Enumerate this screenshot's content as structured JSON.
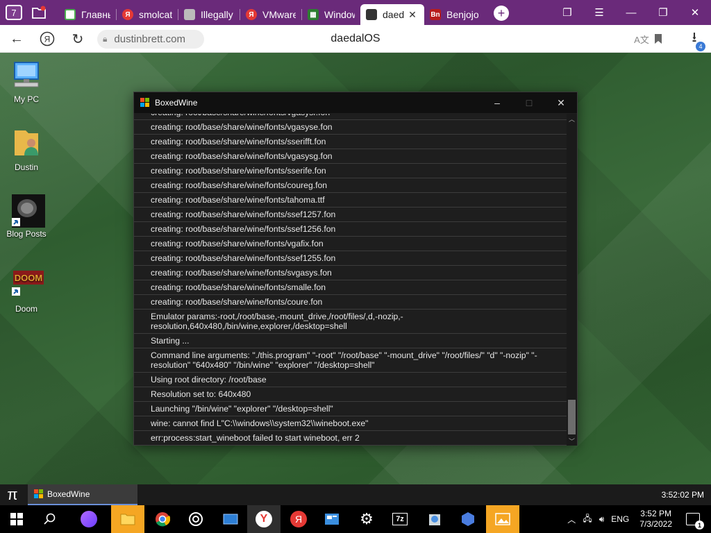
{
  "browser": {
    "tab_counter": "7",
    "tabs": [
      {
        "label": "Главны",
        "fav_color": "#4caf50",
        "icon": "page-icon"
      },
      {
        "label": "smolcat",
        "fav_color": "#e53935",
        "icon": "yandex-icon"
      },
      {
        "label": "Illegally",
        "fav_color": "#9e9e9e",
        "icon": "page-icon"
      },
      {
        "label": "VMware",
        "fav_color": "#e53935",
        "icon": "yandex-icon"
      },
      {
        "label": "Window",
        "fav_color": "#2e7d32",
        "icon": "grid-icon"
      },
      {
        "label": "daed",
        "fav_color": "#333333",
        "icon": "daedalos-icon"
      },
      {
        "label": "Benjojo",
        "fav_color": "#b71c1c",
        "icon": "bn-icon"
      }
    ],
    "url": "dustinbrett.com",
    "page_title": "daedalOS",
    "downloads_count": "4"
  },
  "desktop": {
    "icons": [
      {
        "label": "My PC",
        "icon": "computer-icon"
      },
      {
        "label": "Dustin",
        "icon": "user-folder-icon"
      },
      {
        "label": "Blog Posts",
        "icon": "blog-posts-shortcut-icon"
      },
      {
        "label": "Doom",
        "icon": "doom-shortcut-icon"
      }
    ]
  },
  "window": {
    "title": "BoxedWine",
    "controls": {
      "minimize": "–",
      "maximize": "□",
      "close": "✕"
    },
    "log": [
      "creating: root/base/share/wine/fonts/vgasysr.fon",
      "creating: root/base/share/wine/fonts/vgasyse.fon",
      "creating: root/base/share/wine/fonts/sserifft.fon",
      "creating: root/base/share/wine/fonts/vgasysg.fon",
      "creating: root/base/share/wine/fonts/sserife.fon",
      "creating: root/base/share/wine/fonts/coureg.fon",
      "creating: root/base/share/wine/fonts/tahoma.ttf",
      "creating: root/base/share/wine/fonts/ssef1257.fon",
      "creating: root/base/share/wine/fonts/ssef1256.fon",
      "creating: root/base/share/wine/fonts/vgafix.fon",
      "creating: root/base/share/wine/fonts/ssef1255.fon",
      "creating: root/base/share/wine/fonts/svgasys.fon",
      "creating: root/base/share/wine/fonts/smalle.fon",
      "creating: root/base/share/wine/fonts/coure.fon",
      "Emulator params:-root,/root/base,-mount_drive,/root/files/,d,-nozip,-resolution,640x480,/bin/wine,explorer,/desktop=shell",
      "Starting ...",
      "Command line arguments: \"./this.program\" \"-root\" \"/root/base\" \"-mount_drive\" \"/root/files/\" \"d\" \"-nozip\" \"-resolution\" \"640x480\" \"/bin/wine\" \"explorer\" \"/desktop=shell\"",
      "Using root directory: /root/base",
      "Resolution set to: 640x480",
      "Launching \"/bin/wine\" \"explorer\" \"/desktop=shell\"",
      "wine: cannot find L\"C:\\\\windows\\\\system32\\\\wineboot.exe\"",
      "err:process:start_wineboot failed to start wineboot, err 2"
    ]
  },
  "daedal_taskbar": {
    "start_glyph": "π",
    "entry_label": "BoxedWine",
    "clock": "3:52:02 PM"
  },
  "windows_taskbar": {
    "time": "3:52 PM",
    "date": "7/3/2022",
    "notification_count": "1",
    "apps": [
      "start",
      "search",
      "alice",
      "file-explorer",
      "chrome",
      "media",
      "app",
      "yandex-browser",
      "yandex",
      "app2",
      "settings",
      "7zip",
      "app3",
      "app4",
      "photos"
    ]
  }
}
